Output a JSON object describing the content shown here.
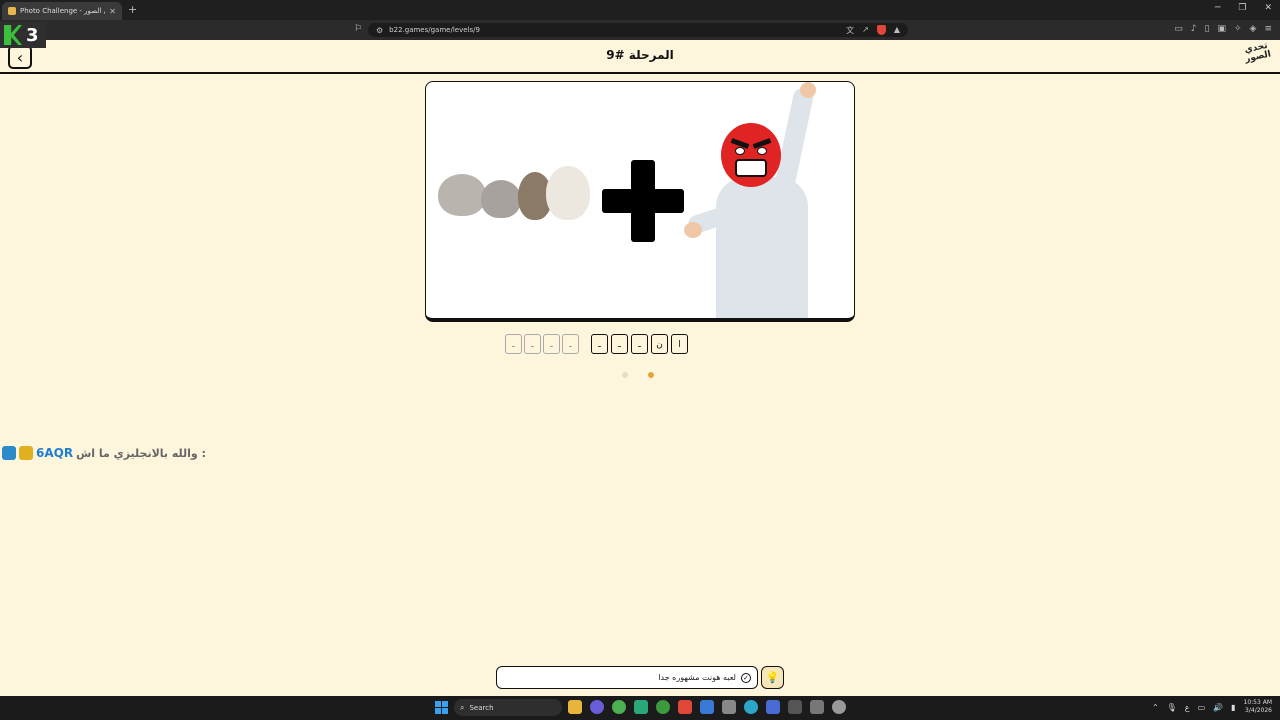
{
  "browser": {
    "tab_title": "Photo Challenge - تحدي الصور",
    "url": "b22.games/game/levels/9"
  },
  "overlay": {
    "counter": "3"
  },
  "header": {
    "title": "المرحلة #9",
    "brand": "تحدي الصور"
  },
  "answer": {
    "word1": [
      "ـ",
      "ـ",
      "ـ",
      "ـ"
    ],
    "word2": [
      "ـ",
      "ـ",
      "ـ",
      "ن",
      "ا"
    ]
  },
  "chat": {
    "user": "6AQR",
    "message": "والله بالانجليزي ما اش :"
  },
  "hint": {
    "text": "لعبه هونت مشهوره جدا"
  },
  "taskbar": {
    "search_label": "Search",
    "time": "10:53 AM",
    "date": "3/4/2026",
    "lang": "ع"
  },
  "colors": {
    "background": "#fdf6dd",
    "accent": "#e8a23a",
    "chat_user": "#1e7fd0"
  }
}
